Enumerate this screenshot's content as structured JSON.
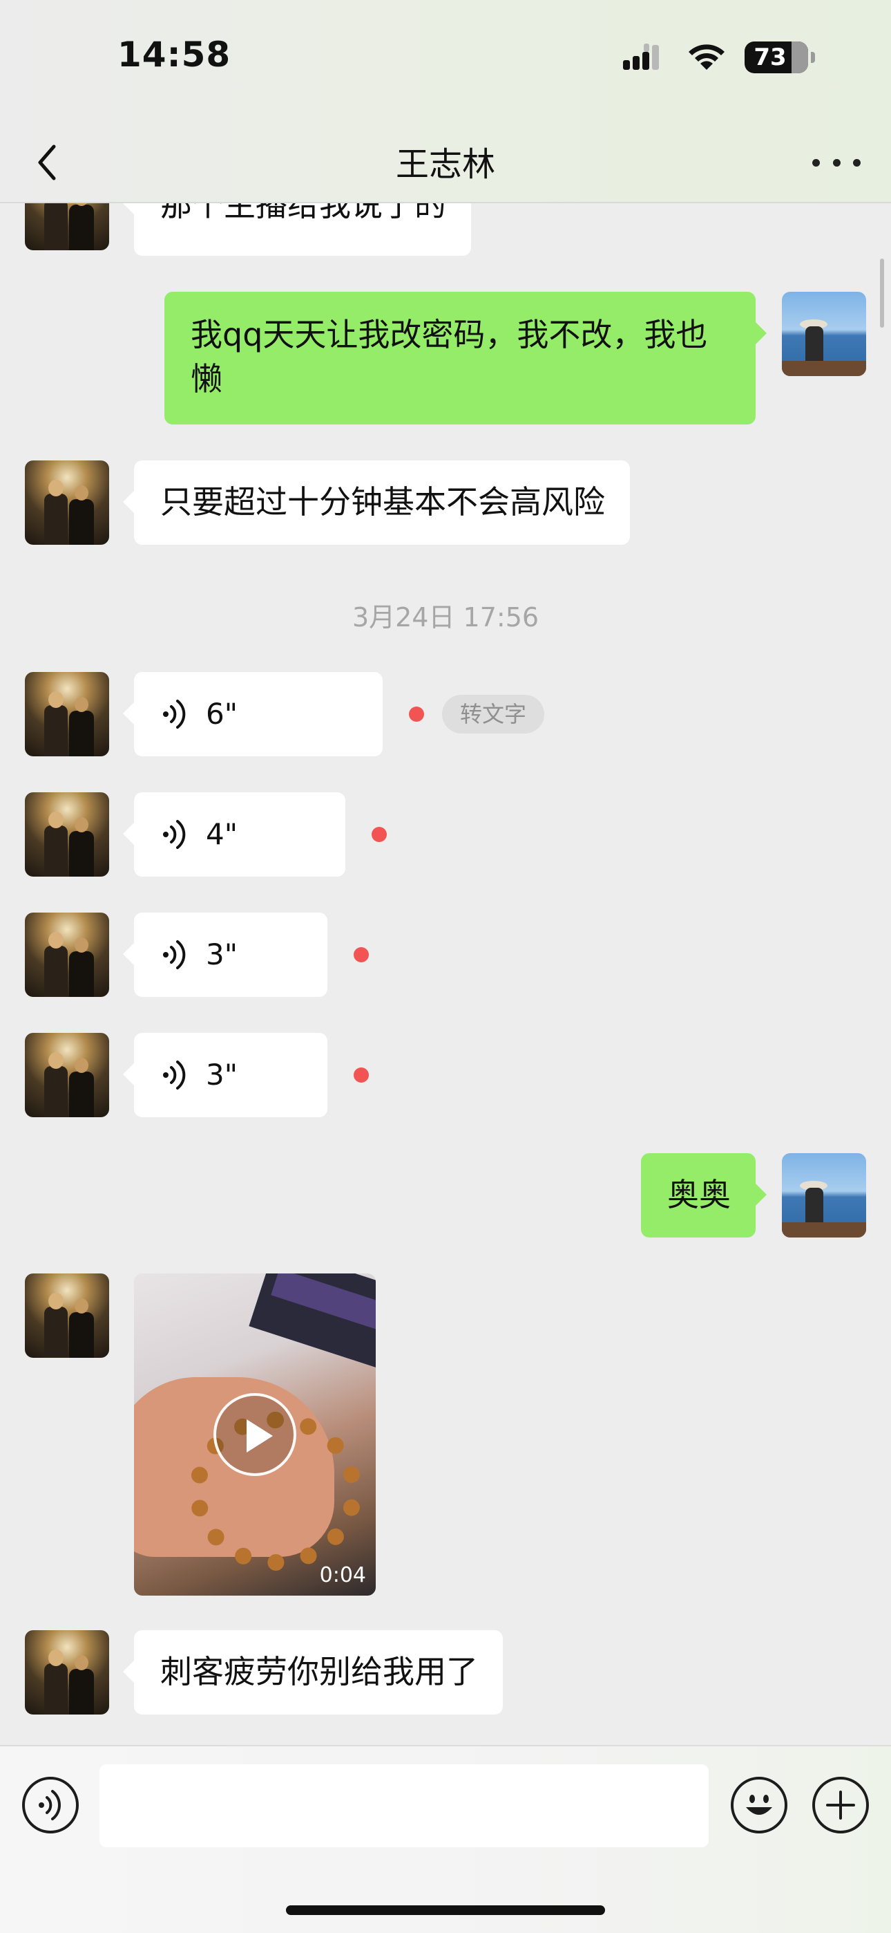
{
  "status_bar": {
    "time": "14:58",
    "battery": "73"
  },
  "nav": {
    "title": "王志林"
  },
  "messages": {
    "partial": "那个主播给我说了的",
    "out_1": "我qq天天让我改密码，我不改，我也懒",
    "in_1": "只要超过十分钟基本不会高风险",
    "timestamp": "3月24日 17:56",
    "voice_1": "6\"",
    "voice_1_action": "转文字",
    "voice_2": "4\"",
    "voice_3": "3\"",
    "voice_4": "3\"",
    "out_2": "奥奥",
    "video_duration": "0:04",
    "in_2": "刺客疲劳你别给我用了"
  },
  "colors": {
    "outgoing_bubble": "#95ec69",
    "incoming_bubble": "#ffffff",
    "unread_dot": "#f25454",
    "background": "#ededed"
  }
}
